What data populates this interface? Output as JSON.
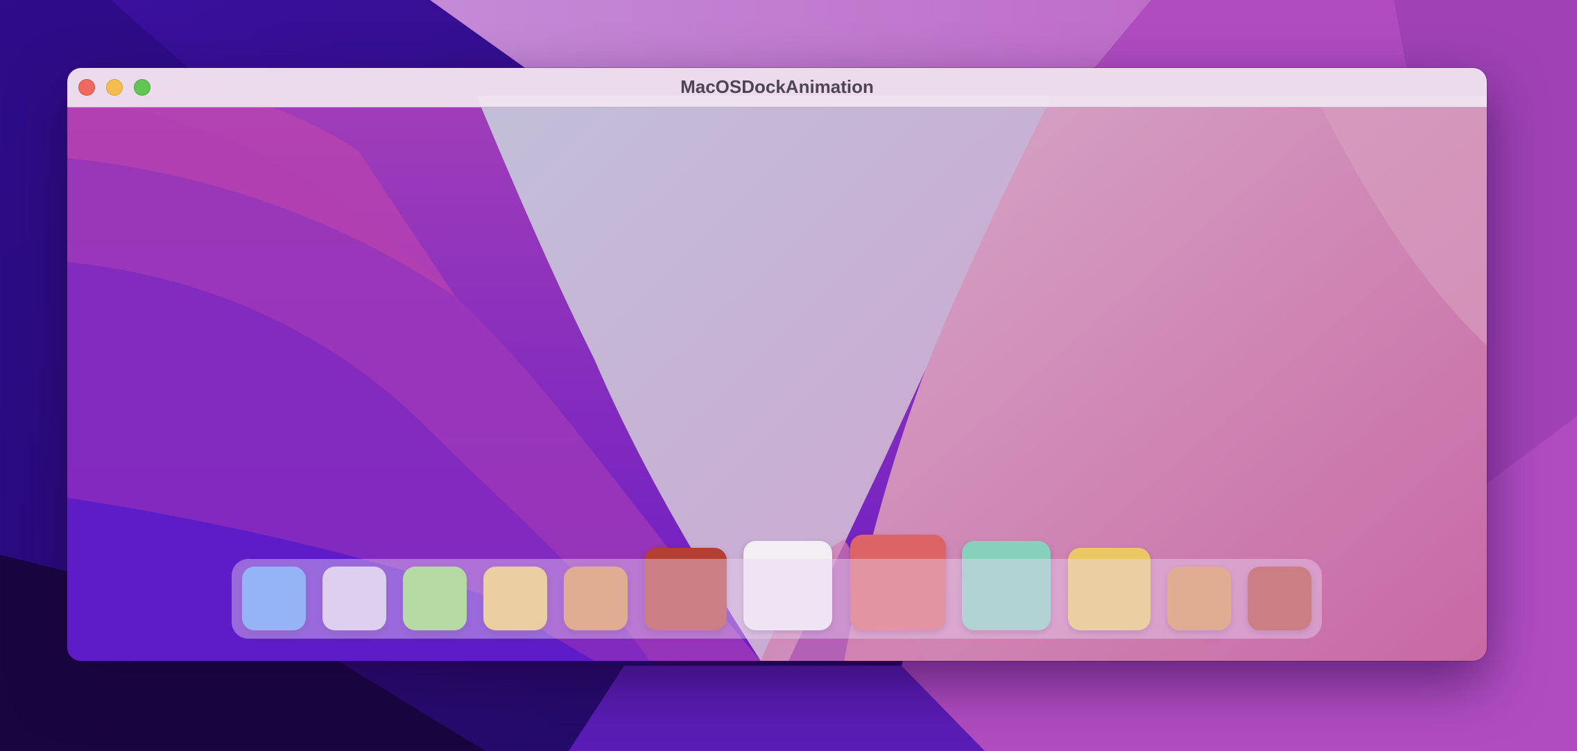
{
  "window": {
    "title": "MacOSDockAnimation"
  },
  "traffic_lights": {
    "close_icon": "close-icon",
    "minimize_icon": "minimize-icon",
    "zoom_icon": "zoom-icon",
    "colors": {
      "close": "#ee6a5f",
      "minimize": "#f5bd4f",
      "zoom": "#61c454"
    }
  },
  "dock": {
    "items": [
      {
        "color": "#569cf9"
      },
      {
        "color": "#d0cbe9"
      },
      {
        "color": "#8fdc6a"
      },
      {
        "color": "#ebc865"
      },
      {
        "color": "#d88f4c"
      },
      {
        "color": "#b43e31"
      },
      {
        "color": "#f2eef3"
      },
      {
        "color": "#dc6466"
      },
      {
        "color": "#87d0bb"
      },
      {
        "color": "#ebc865"
      },
      {
        "color": "#d88f4c"
      },
      {
        "color": "#b43e31"
      }
    ]
  }
}
